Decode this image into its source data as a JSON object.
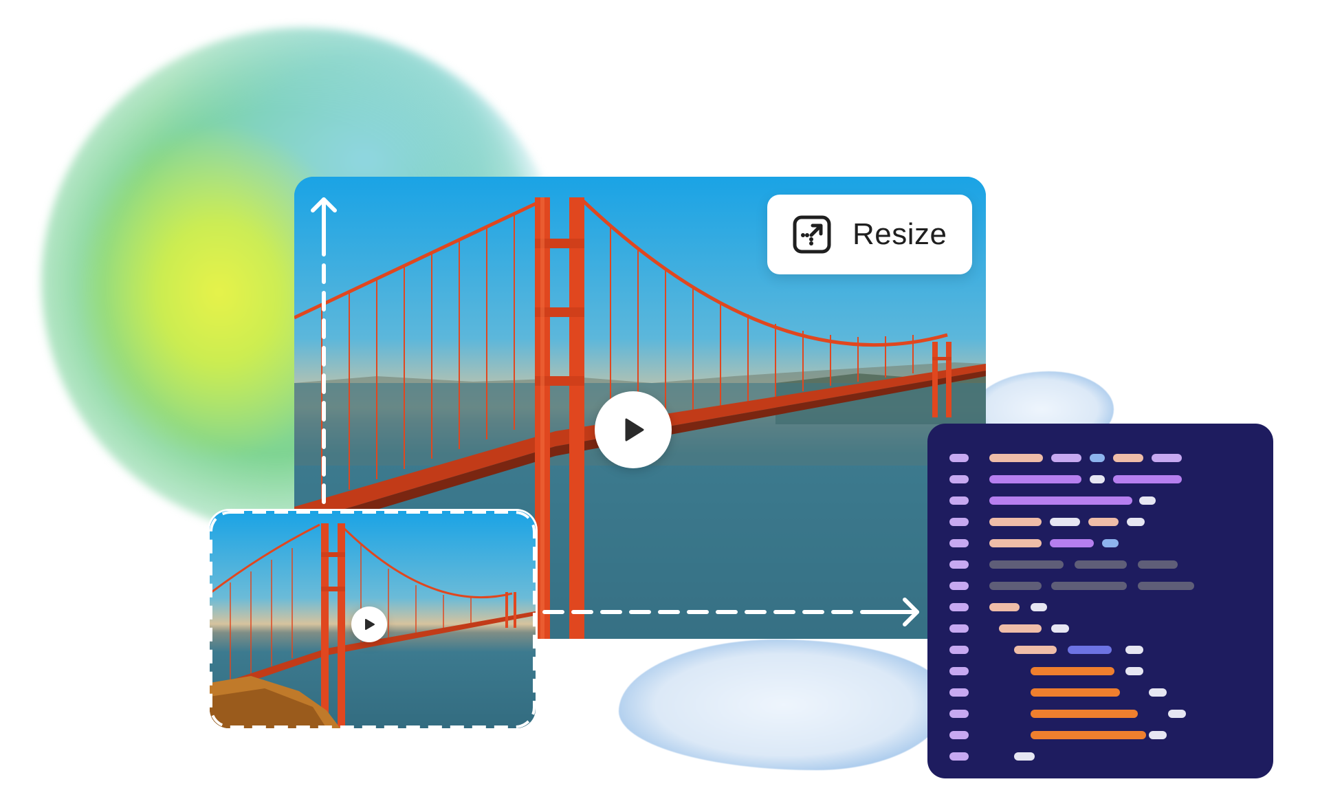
{
  "resize_button": {
    "label": "Resize",
    "icon": "resize-icon"
  },
  "icons": {
    "main_play": "play-icon",
    "thumb_play": "play-icon",
    "up_arrow": "arrow-up-icon",
    "right_arrow": "arrow-right-icon"
  },
  "colors": {
    "code_panel_bg": "#1e1c5f",
    "code_lilac": "#c7a9f1",
    "code_purple": "#b67fef",
    "code_peach": "#efbda8",
    "code_light": "#e6e6f2",
    "code_blue": "#8db4ee",
    "code_gray": "#5f5e78",
    "code_orange": "#ef7f2e",
    "code_indigo": "#6d73e3",
    "bridge": "#e0471f"
  }
}
